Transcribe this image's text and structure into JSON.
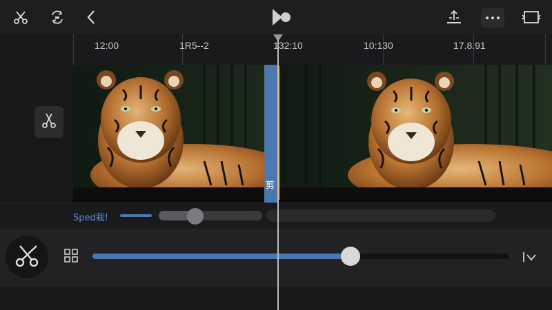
{
  "toolbar": {
    "buttons": [
      {
        "name": "scissors-icon"
      },
      {
        "name": "swap-icon"
      },
      {
        "name": "back-chevron-icon"
      },
      {
        "name": "app-logo-icon"
      },
      {
        "name": "export-icon"
      },
      {
        "name": "more-icon"
      },
      {
        "name": "fullscreen-icon"
      }
    ]
  },
  "ruler": {
    "ticks": [
      "12:00",
      "1R5--2",
      "132:10",
      "10:130",
      "17.8.91"
    ]
  },
  "timeline": {
    "clips": [
      {
        "subject": "tiger"
      },
      {
        "subject": "tiger"
      }
    ],
    "cut_label": "剪"
  },
  "speed": {
    "label": "Sped栽!",
    "level": 0.35
  },
  "bottom": {
    "slider_value": 0.62
  },
  "colors": {
    "accent": "#4a78b0",
    "playhead_yellow": "#e8c33a",
    "background": "#141415"
  }
}
